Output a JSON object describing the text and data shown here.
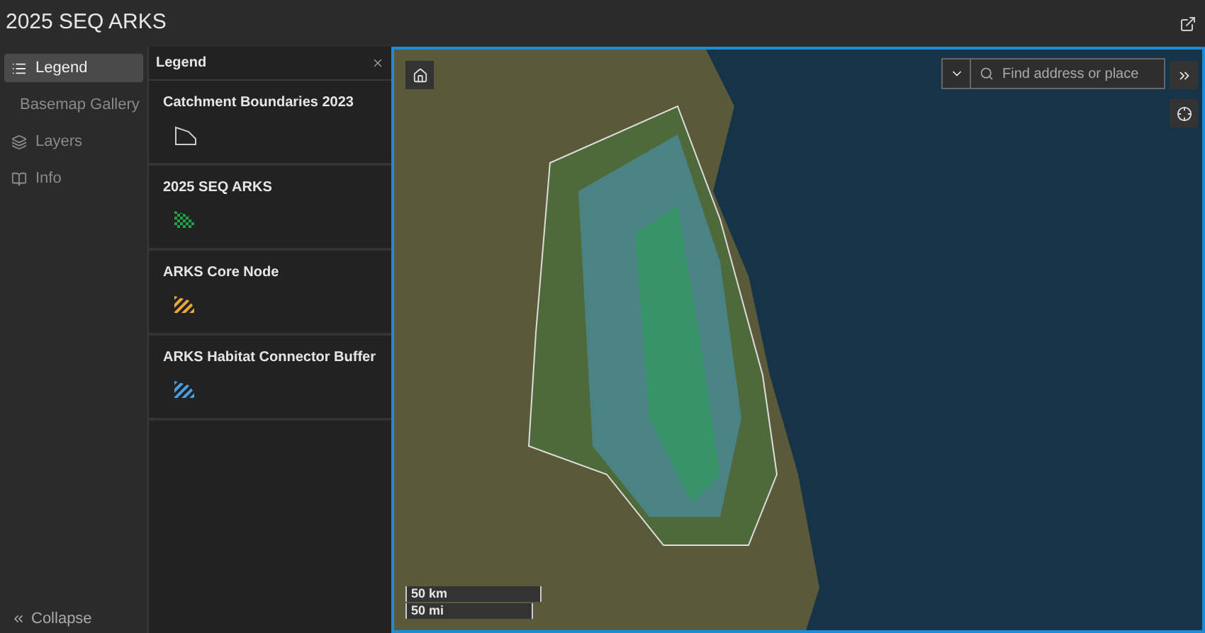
{
  "app_title": "2025 SEQ ARKS",
  "nav": [
    {
      "label": "Legend",
      "selected": true
    },
    {
      "label": "Basemap Gallery",
      "selected": false
    },
    {
      "label": "Layers",
      "selected": false
    },
    {
      "label": "Info",
      "selected": false
    }
  ],
  "collapse": "Collapse",
  "legend": {
    "title": "Legend",
    "layers": [
      {
        "name": "Catchment Boundaries 2023",
        "kind": "outline"
      },
      {
        "name": "2025 SEQ ARKS",
        "kind": "checker",
        "color": "#1fa34a"
      },
      {
        "name": "ARKS Core Node",
        "kind": "hatch",
        "color": "#e8a93a"
      },
      {
        "name": "ARKS Habitat Connector Buffer",
        "kind": "hatch",
        "color": "#4a9fe0"
      }
    ]
  },
  "map": {
    "search": {
      "placeholder": "Find address or place"
    },
    "scale": [
      "50 km",
      "50 mi"
    ]
  }
}
